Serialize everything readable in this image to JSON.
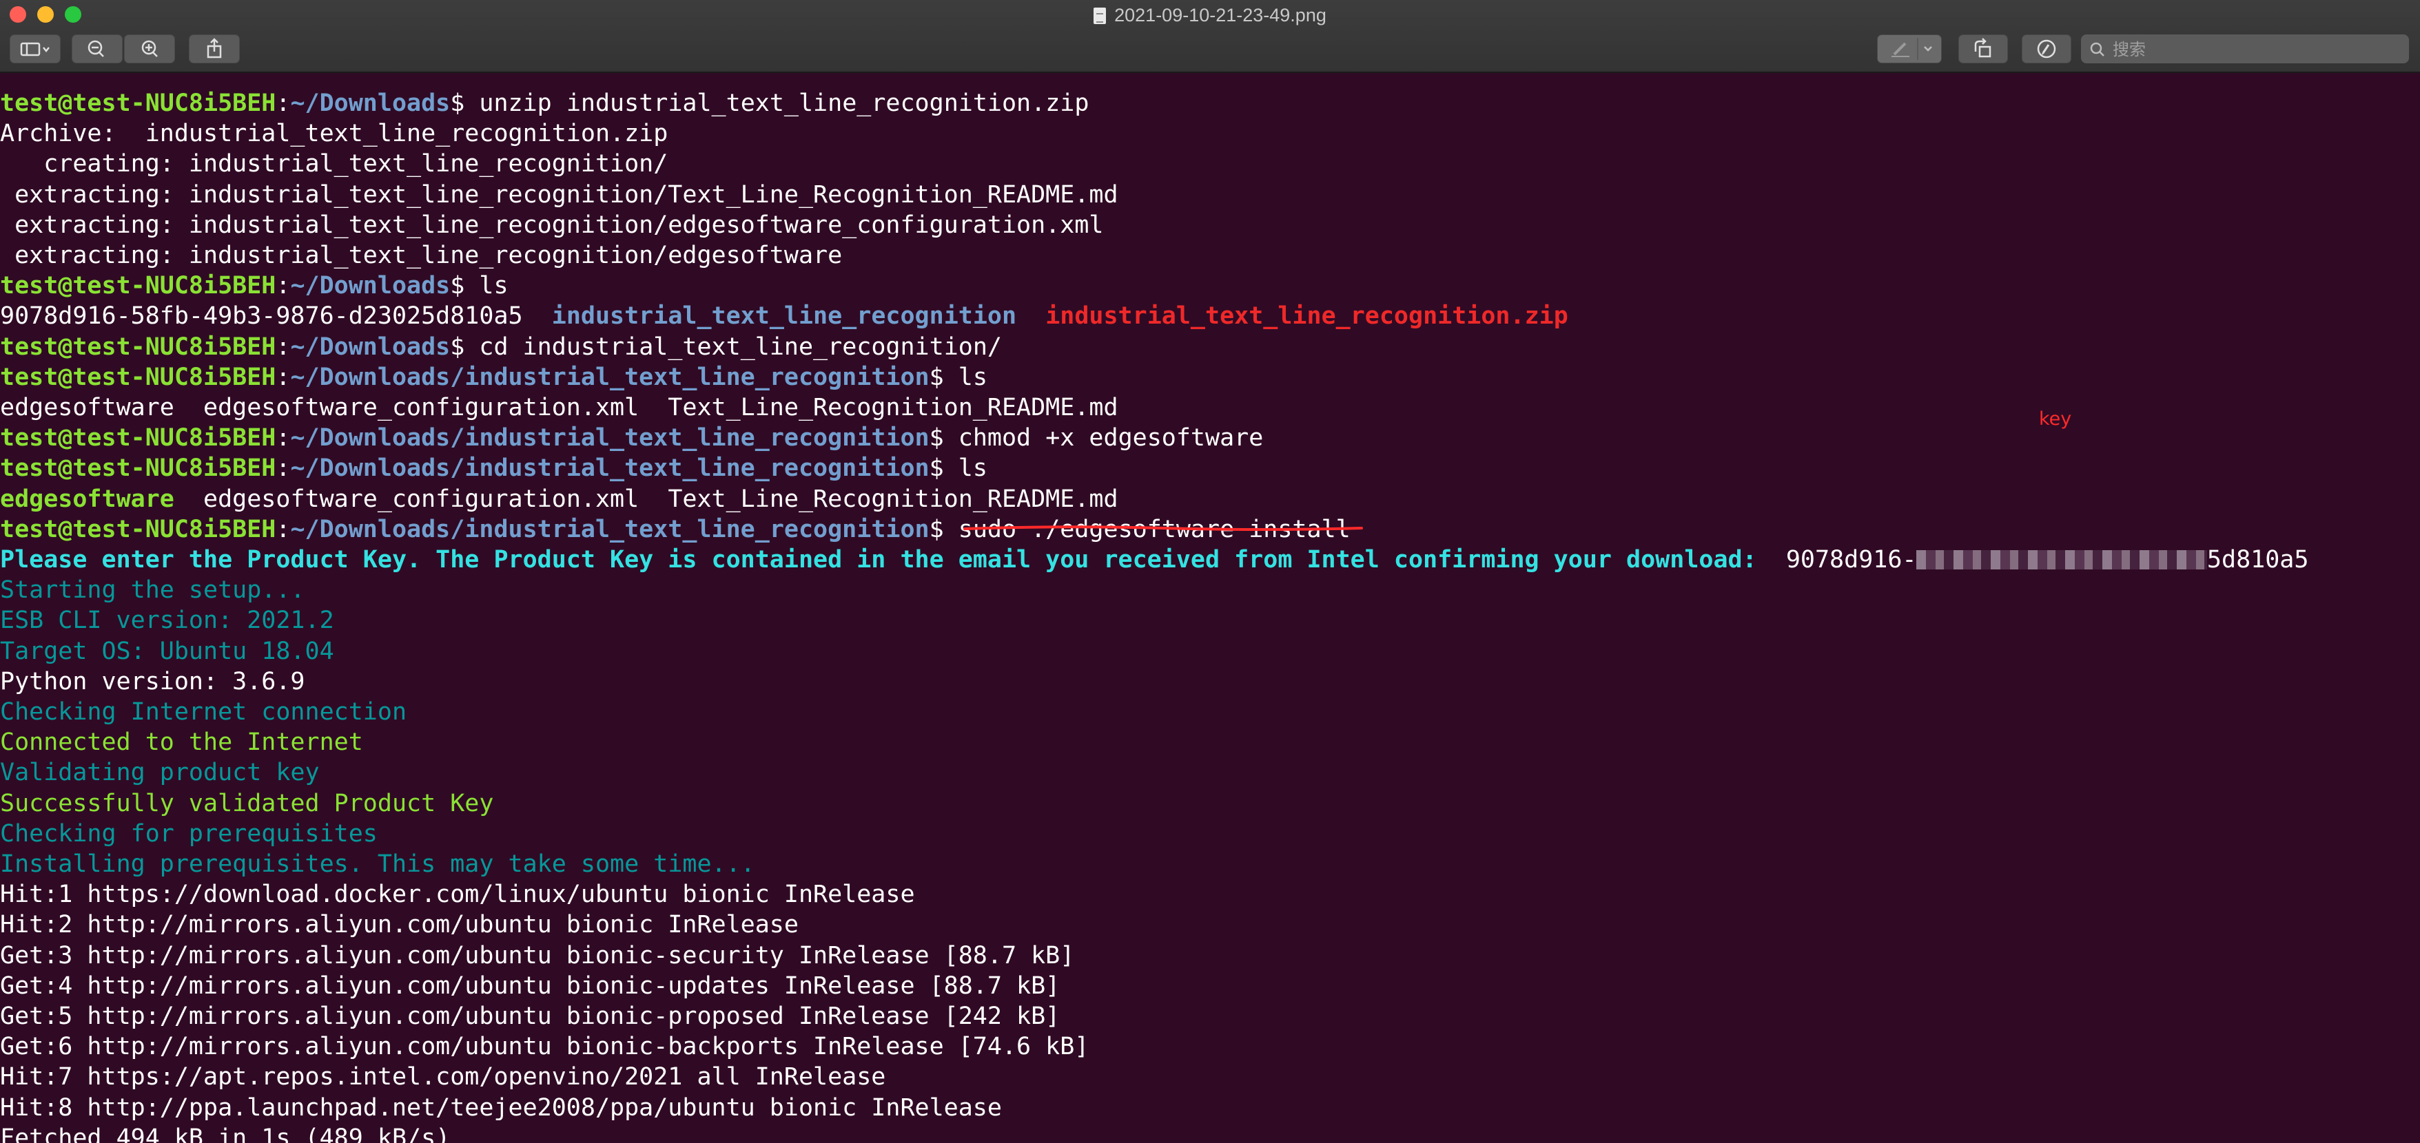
{
  "window": {
    "title": "2021-09-10-21-23-49.png"
  },
  "toolbar": {
    "search_placeholder": "搜索",
    "icons": [
      "sidebar-icon",
      "chevron-down-icon",
      "zoom-out-icon",
      "zoom-in-icon",
      "share-icon",
      "markup-pen-icon",
      "rotate-icon",
      "annotate-icon",
      "search-icon"
    ]
  },
  "annotation": {
    "key_label": "key",
    "color": "#ff2a2a"
  },
  "colors": {
    "terminal_bg": "#300a24",
    "prompt_user": "#8ae234",
    "prompt_path": "#729fcf",
    "archive_red": "#ef2929",
    "setup_cyan": "#06989a",
    "success_green": "#8ae234"
  },
  "terminal": {
    "prompt_user": "test@test-NUC8i5BEH",
    "lines": [
      {
        "path": "~/Downloads",
        "cmd": " unzip industrial_text_line_recognition.zip"
      },
      {
        "text": "Archive:  industrial_text_line_recognition.zip"
      },
      {
        "text": "   creating: industrial_text_line_recognition/"
      },
      {
        "text": " extracting: industrial_text_line_recognition/Text_Line_Recognition_README.md"
      },
      {
        "text": " extracting: industrial_text_line_recognition/edgesoftware_configuration.xml"
      },
      {
        "text": " extracting: industrial_text_line_recognition/edgesoftware"
      },
      {
        "path": "~/Downloads",
        "cmd": " ls"
      },
      {
        "ls_a": "9078d916-58fb-49b3-9876-d23025d810a5",
        "ls_b": "industrial_text_line_recognition",
        "ls_c": "industrial_text_line_recognition.zip"
      },
      {
        "path": "~/Downloads",
        "cmd": " cd industrial_text_line_recognition/"
      },
      {
        "path": "~/Downloads/industrial_text_line_recognition",
        "cmd": " ls"
      },
      {
        "text": "edgesoftware  edgesoftware_configuration.xml  Text_Line_Recognition_README.md"
      },
      {
        "path": "~/Downloads/industrial_text_line_recognition",
        "cmd": " chmod +x edgesoftware"
      },
      {
        "path": "~/Downloads/industrial_text_line_recognition",
        "cmd": " ls"
      },
      {
        "exec": "edgesoftware",
        "rest": "  edgesoftware_configuration.xml  Text_Line_Recognition_README.md"
      },
      {
        "path": "~/Downloads/industrial_text_line_recognition",
        "cmd": " sudo ./edgesoftware install"
      },
      {
        "prompt_text": "Please enter the Product Key. The Product Key is contained in the email you received from Intel confirming your download:",
        "key_visible_start": "  9078d916-",
        "key_hidden": "58fb-49b3-9876-d2302",
        "key_visible_end": "5d810a5"
      },
      {
        "text": "Starting the setup...",
        "style": "cyan"
      },
      {
        "text": "ESB CLI version: 2021.2",
        "style": "cyan"
      },
      {
        "text": "Target OS: Ubuntu 18.04",
        "style": "cyan"
      },
      {
        "text": "Python version: 3.6.9",
        "style": "white"
      },
      {
        "text": "Checking Internet connection",
        "style": "cyan"
      },
      {
        "text": "Connected to the Internet",
        "style": "lgreen"
      },
      {
        "text": "Validating product key",
        "style": "cyan"
      },
      {
        "text": "Successfully validated Product Key",
        "style": "lgreen"
      },
      {
        "text": "Checking for prerequisites",
        "style": "cyan"
      },
      {
        "text": "Installing prerequisites. This may take some time...",
        "style": "cyan"
      },
      {
        "text": "Hit:1 https://download.docker.com/linux/ubuntu bionic InRelease"
      },
      {
        "text": "Hit:2 http://mirrors.aliyun.com/ubuntu bionic InRelease"
      },
      {
        "text": "Get:3 http://mirrors.aliyun.com/ubuntu bionic-security InRelease [88.7 kB]"
      },
      {
        "text": "Get:4 http://mirrors.aliyun.com/ubuntu bionic-updates InRelease [88.7 kB]"
      },
      {
        "text": "Get:5 http://mirrors.aliyun.com/ubuntu bionic-proposed InRelease [242 kB]"
      },
      {
        "text": "Get:6 http://mirrors.aliyun.com/ubuntu bionic-backports InRelease [74.6 kB]"
      },
      {
        "text": "Hit:7 https://apt.repos.intel.com/openvino/2021 all InRelease"
      },
      {
        "text": "Hit:8 http://ppa.launchpad.net/teejee2008/ppa/ubuntu bionic InRelease"
      },
      {
        "text": "Fetched 494 kB in 1s (489 kB/s)"
      }
    ]
  }
}
